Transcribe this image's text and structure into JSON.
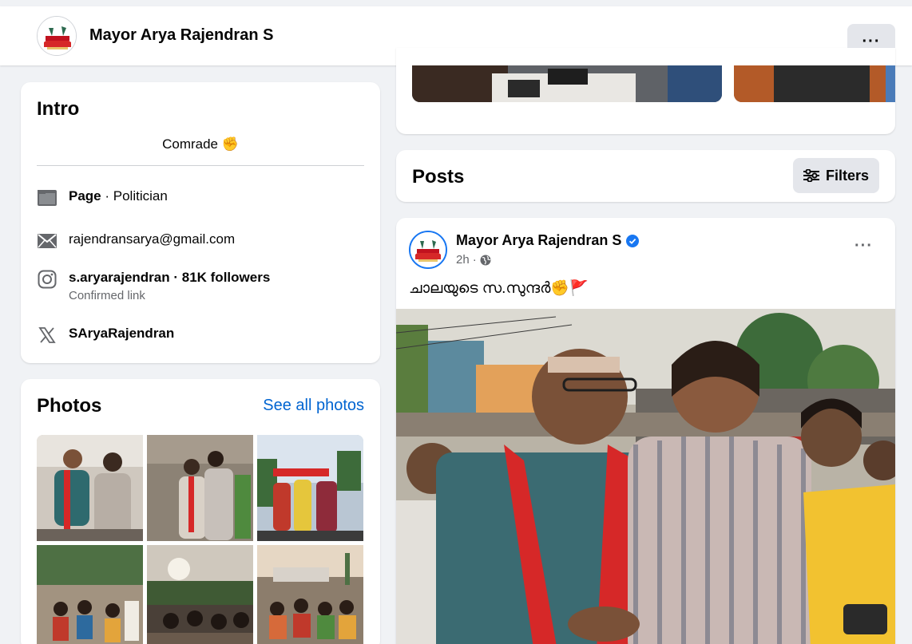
{
  "header": {
    "title": "Mayor Arya Rajendran S",
    "more_label": "···"
  },
  "intro": {
    "heading": "Intro",
    "bio": "Comrade ✊",
    "category_strong": "Page",
    "category_rest": " · Politician",
    "email": "rajendransarya@gmail.com",
    "instagram": "s.aryarajendran · 81K followers",
    "instagram_note": "Confirmed link",
    "x_handle": "SAryaRajendran"
  },
  "photos": {
    "heading": "Photos",
    "see_all": "See all photos"
  },
  "posts_header": {
    "heading": "Posts",
    "filters_label": "Filters"
  },
  "post": {
    "author": "Mayor Arya Rajendran S",
    "time": "2h",
    "separator": "·",
    "text": "ചാലയുടെ സ.സുന്ദർ✊🚩",
    "more_label": "···"
  },
  "colors": {
    "link": "#0064d1",
    "verified": "#1877f2",
    "background": "#f0f2f5"
  }
}
